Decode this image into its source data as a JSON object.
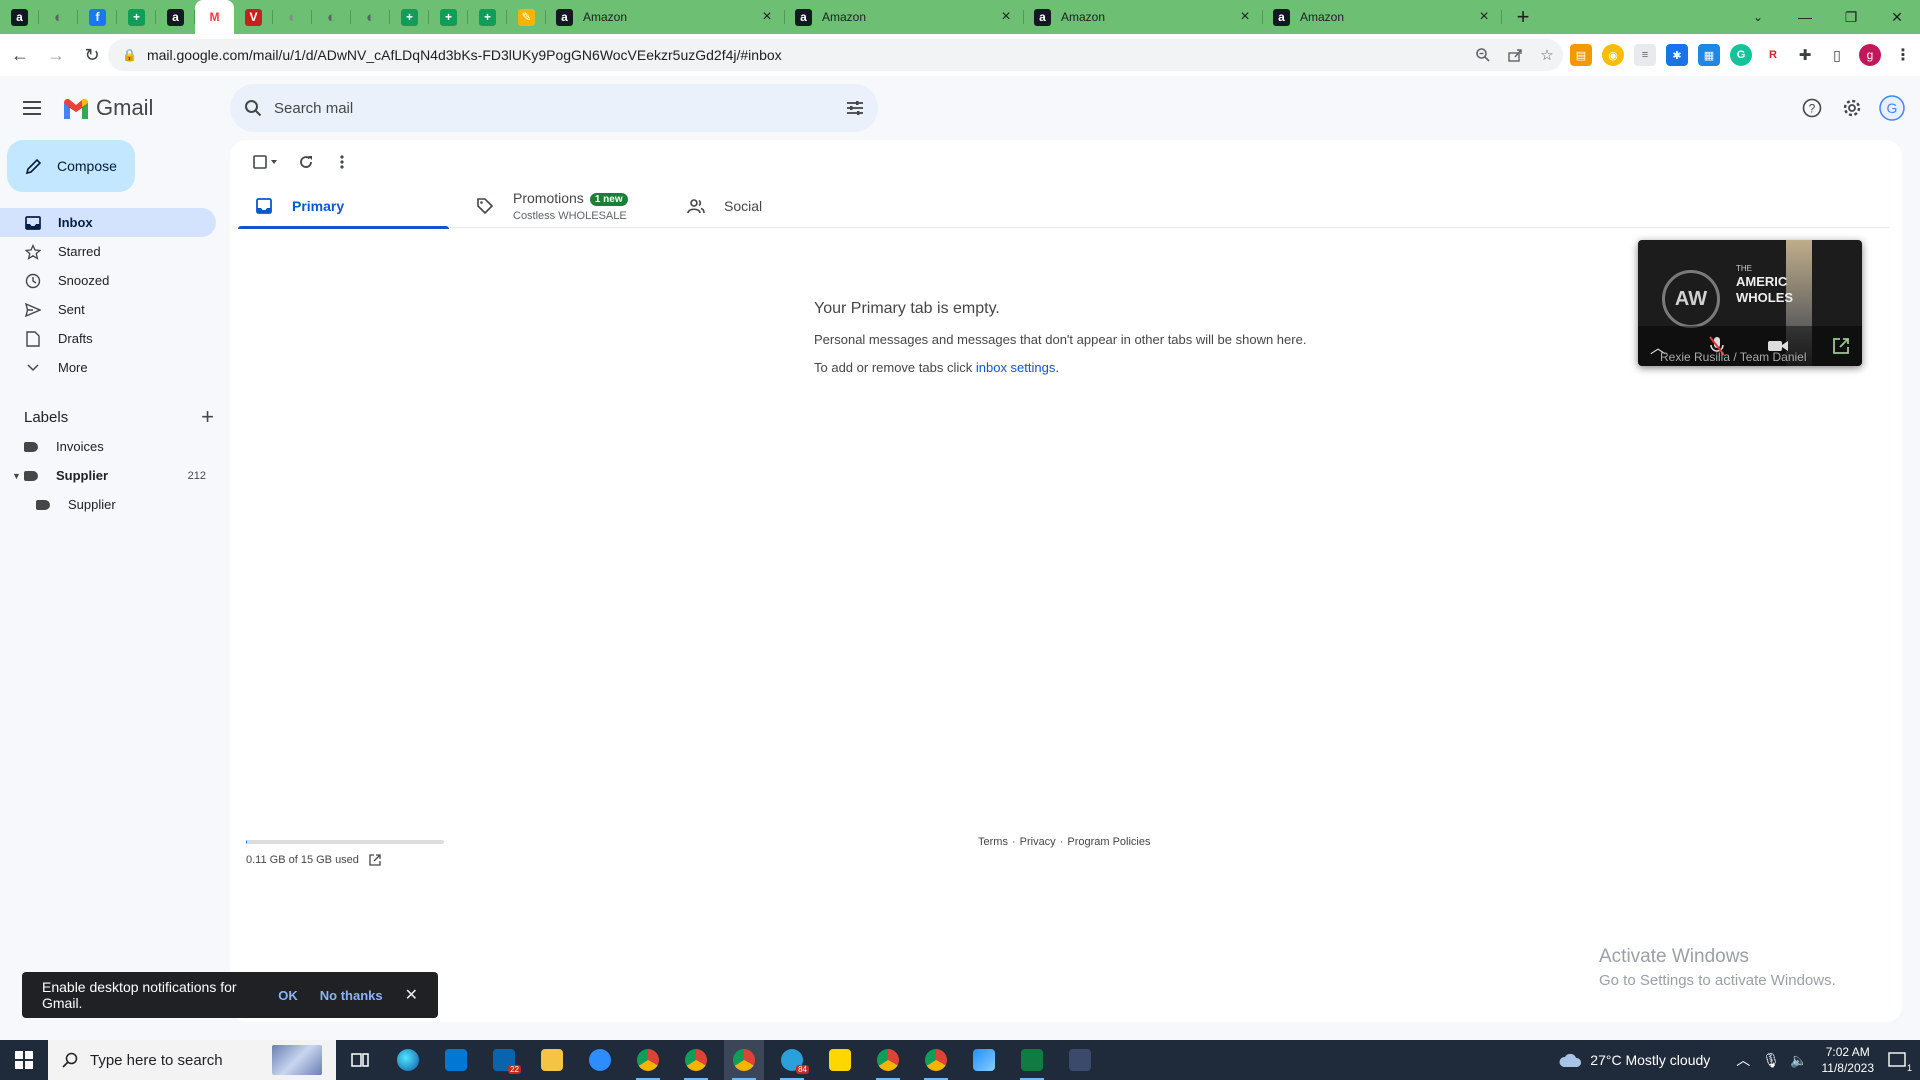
{
  "browser": {
    "pinned_tabs": [
      {
        "icon": "amazon-icon",
        "glyph": "a",
        "color": "#131921"
      },
      {
        "icon": "globe-icon",
        "glyph": "◐",
        "color": "#5f6368"
      },
      {
        "icon": "facebook-icon",
        "glyph": "f",
        "color": "#1877f2"
      },
      {
        "icon": "sheets-icon",
        "glyph": "+",
        "color": "#0f9d58"
      },
      {
        "icon": "amazon-icon",
        "glyph": "a",
        "color": "#131921"
      },
      {
        "icon": "gmail-icon",
        "glyph": "M",
        "color": "#ffffff"
      },
      {
        "icon": "red-v-icon",
        "glyph": "V",
        "color": "#c5221f"
      },
      {
        "icon": "globe-icon",
        "glyph": "◐",
        "color": "#8a8a8a"
      },
      {
        "icon": "globe-icon",
        "glyph": "◐",
        "color": "#5f6368"
      },
      {
        "icon": "globe-icon",
        "glyph": "◐",
        "color": "#5f6368"
      },
      {
        "icon": "sheets-icon",
        "glyph": "+",
        "color": "#0f9d58"
      },
      {
        "icon": "sheets-icon",
        "glyph": "+",
        "color": "#0f9d58"
      },
      {
        "icon": "sheets-icon",
        "glyph": "+",
        "color": "#0f9d58"
      },
      {
        "icon": "pencil-ext-icon",
        "glyph": "✎",
        "color": "#f4b400"
      }
    ],
    "tabs": [
      {
        "title": "Amazon"
      },
      {
        "title": "Amazon"
      },
      {
        "title": "Amazon"
      },
      {
        "title": "Amazon"
      }
    ],
    "url": "mail.google.com/mail/u/1/d/ADwNV_cAfLDqN4d3bKs-FD3lUKy9PogGN6WocVEekzr5uzGd2f4j/#inbox",
    "profile_initial": "g"
  },
  "gmail": {
    "brand": "Gmail",
    "search_placeholder": "Search mail",
    "compose_label": "Compose",
    "nav": [
      {
        "id": "inbox",
        "label": "Inbox",
        "icon": "inbox-icon",
        "active": true
      },
      {
        "id": "starred",
        "label": "Starred",
        "icon": "star-icon"
      },
      {
        "id": "snoozed",
        "label": "Snoozed",
        "icon": "clock-icon"
      },
      {
        "id": "sent",
        "label": "Sent",
        "icon": "send-icon"
      },
      {
        "id": "drafts",
        "label": "Drafts",
        "icon": "draft-icon"
      },
      {
        "id": "more",
        "label": "More",
        "icon": "chevron-down-icon"
      }
    ],
    "labels_title": "Labels",
    "labels": [
      {
        "name": "Invoices",
        "count": ""
      },
      {
        "name": "Supplier",
        "count": "212"
      },
      {
        "name": "Supplier",
        "count": ""
      }
    ],
    "tabs": {
      "primary": "Primary",
      "promotions": "Promotions",
      "promotions_badge": "1 new",
      "promotions_sub": "Costless WHOLESALE",
      "social": "Social"
    },
    "empty": {
      "heading": "Your Primary tab is empty.",
      "line1": "Personal messages and messages that don't appear in other tabs will be shown here.",
      "line2_prefix": "To add or remove tabs click ",
      "line2_link": "inbox settings",
      "line2_suffix": "."
    },
    "storage": {
      "text": "0.11 GB of 15 GB used",
      "fraction": 0.0073
    },
    "footer": {
      "terms": "Terms",
      "privacy": "Privacy",
      "policies": "Program Policies",
      "sep": "·"
    },
    "video": {
      "small": "THE",
      "title1": "AMERIC",
      "title2": "WHOLES",
      "caption": "Rexie Rusilla / Team Daniel",
      "logo": "AW"
    },
    "toast": {
      "message": "Enable desktop notifications for Gmail.",
      "ok": "OK",
      "no": "No thanks"
    }
  },
  "watermark": {
    "line1": "Activate Windows",
    "line2": "Go to Settings to activate Windows."
  },
  "taskbar": {
    "search_placeholder": "Type here to search",
    "mail_badge": "22",
    "telegram_badge": "84",
    "weather": "27°C  Mostly cloudy",
    "time": "7:02 AM",
    "date": "11/8/2023",
    "notif_count": "1"
  }
}
